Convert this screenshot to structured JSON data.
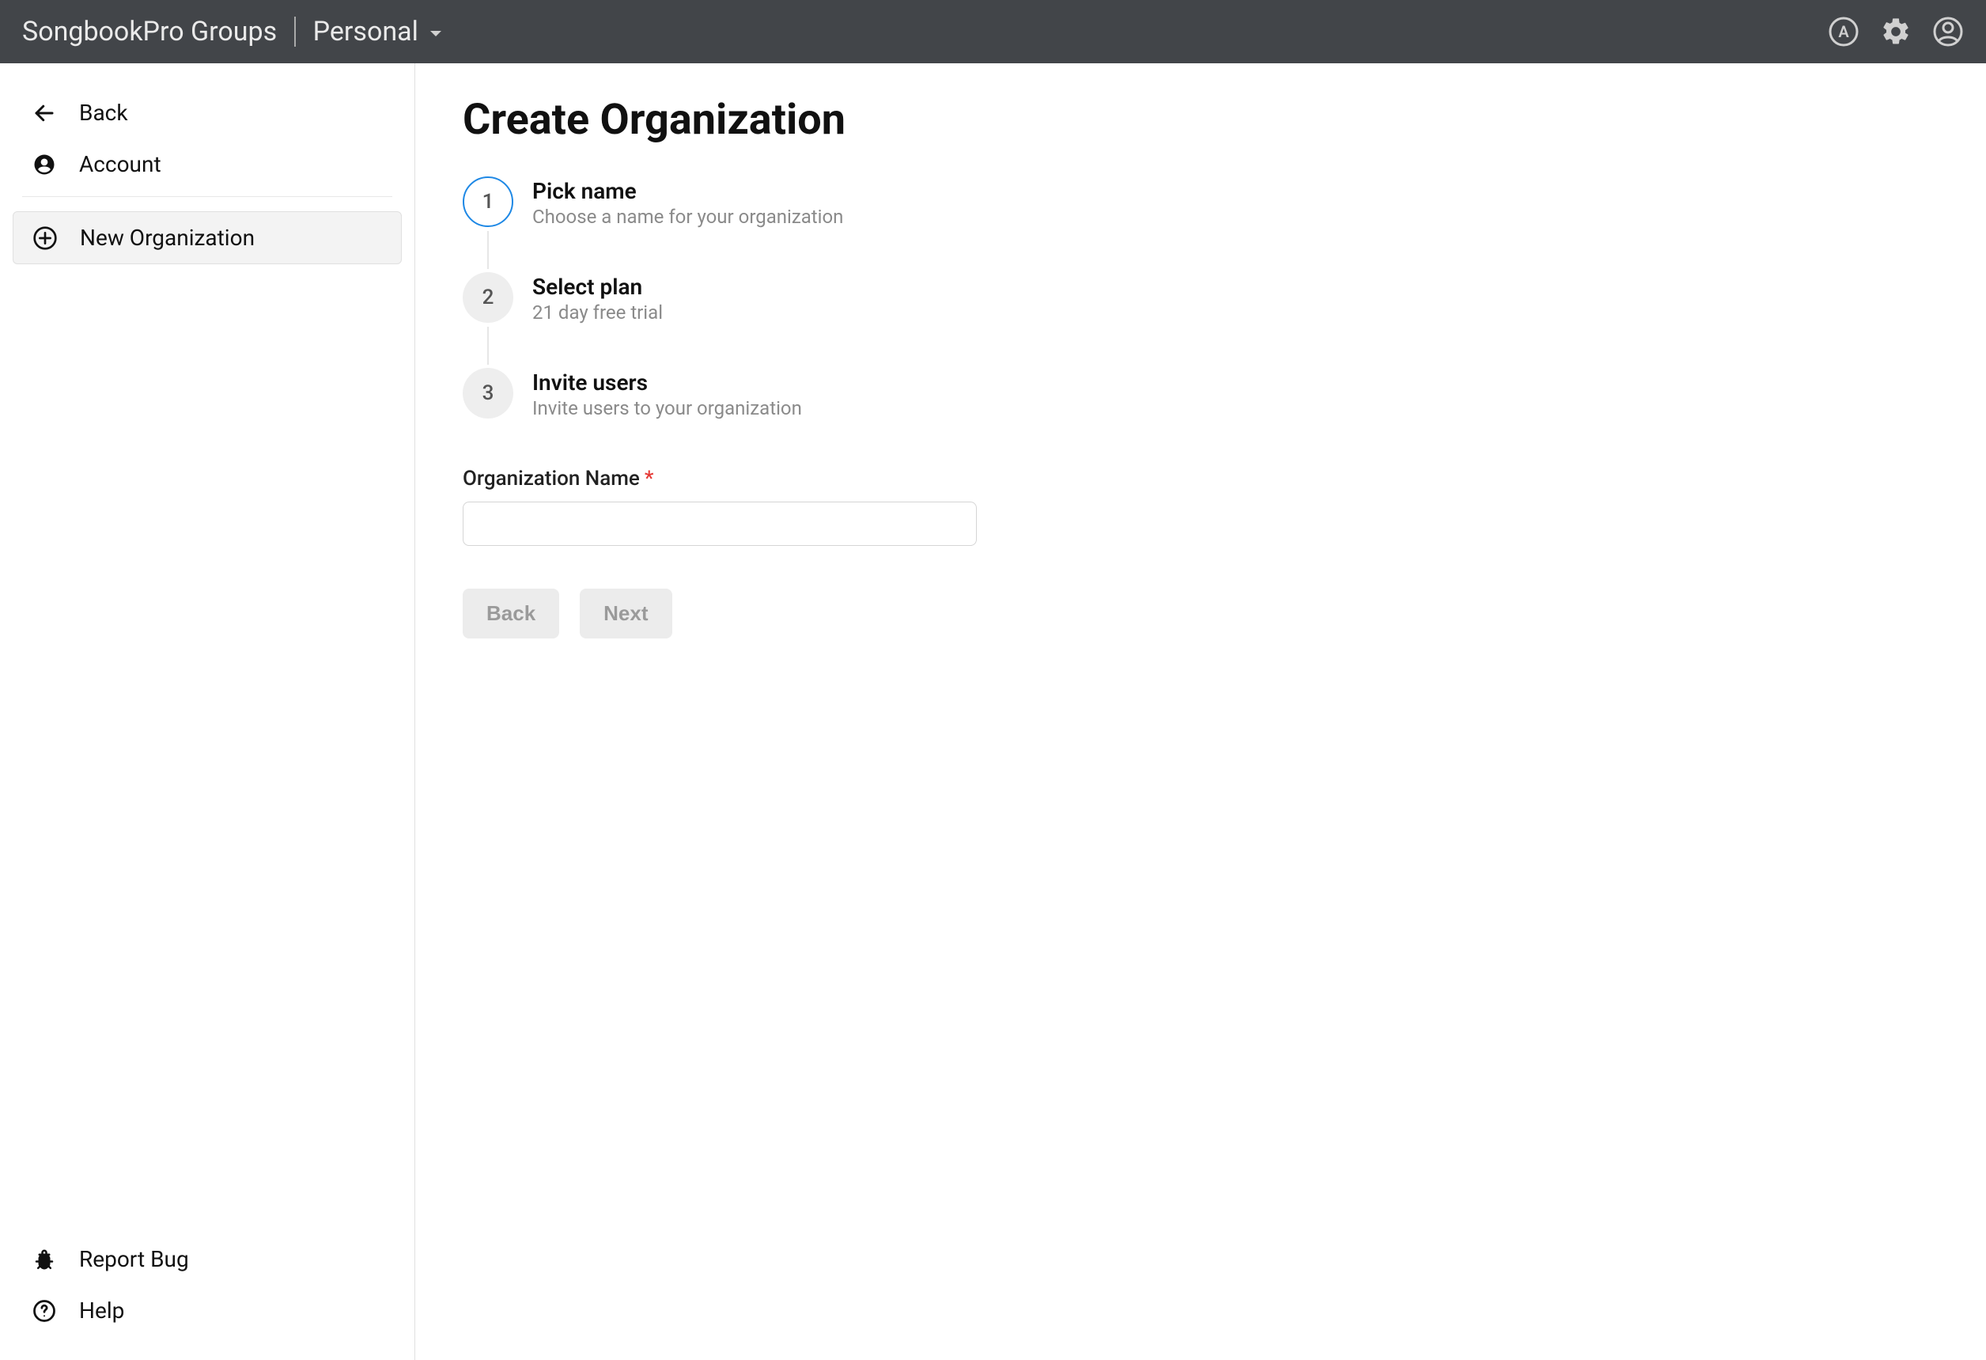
{
  "header": {
    "title": "SongbookPro Groups",
    "scope": "Personal"
  },
  "sidebar": {
    "back": "Back",
    "account": "Account",
    "new_org": "New Organization",
    "report_bug": "Report Bug",
    "help": "Help"
  },
  "page": {
    "title": "Create Organization"
  },
  "steps": [
    {
      "num": "1",
      "title": "Pick name",
      "sub": "Choose a name for your organization",
      "active": true
    },
    {
      "num": "2",
      "title": "Select plan",
      "sub": "21 day free trial",
      "active": false
    },
    {
      "num": "3",
      "title": "Invite users",
      "sub": "Invite users to your organization",
      "active": false
    }
  ],
  "form": {
    "org_name_label": "Organization Name",
    "org_name_value": ""
  },
  "buttons": {
    "back": "Back",
    "next": "Next"
  }
}
